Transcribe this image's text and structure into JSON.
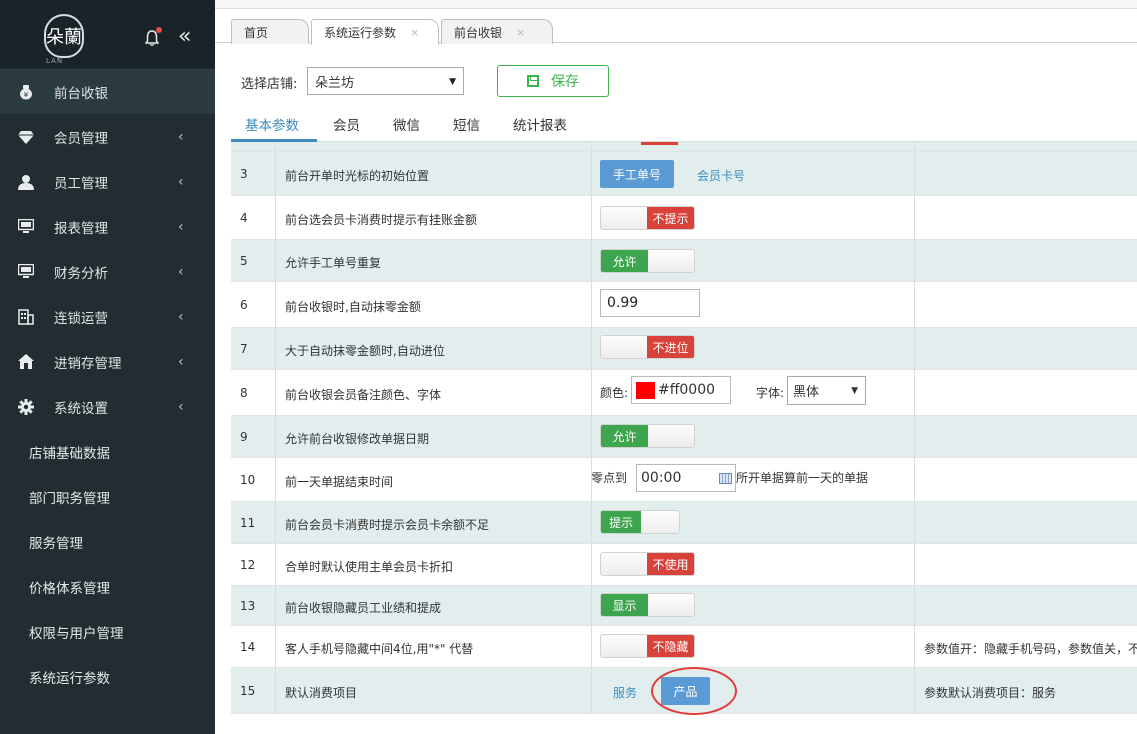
{
  "sidebar": {
    "logo_text": "朵蘭",
    "menu": [
      {
        "label": "前台收银",
        "icon": "money-bag-icon"
      },
      {
        "label": "会员管理",
        "icon": "diamond-icon"
      },
      {
        "label": "员工管理",
        "icon": "user-icon"
      },
      {
        "label": "报表管理",
        "icon": "monitor-icon"
      },
      {
        "label": "财务分析",
        "icon": "monitor-icon"
      },
      {
        "label": "连锁运营",
        "icon": "building-icon"
      },
      {
        "label": "进销存管理",
        "icon": "home-icon"
      },
      {
        "label": "系统设置",
        "icon": "gear-icon"
      }
    ],
    "submenu": [
      "店铺基础数据",
      "部门职务管理",
      "服务管理",
      "价格体系管理",
      "权限与用户管理",
      "系统运行参数"
    ]
  },
  "tabs": [
    {
      "label": "首页"
    },
    {
      "label": "系统运行参数",
      "close": "×"
    },
    {
      "label": "前台收银",
      "close": "×"
    }
  ],
  "toolbar": {
    "store_label": "选择店铺:",
    "store_value": "朵兰坊",
    "save_label": "保存"
  },
  "subtabs": [
    "基本参数",
    "会员",
    "微信",
    "短信",
    "统计报表"
  ],
  "rows": [
    {
      "no": "3",
      "name": "前台开单时光标的初始位置",
      "btn": "手工单号",
      "link": "会员卡号"
    },
    {
      "no": "4",
      "name": "前台选会员卡消费时提示有挂账金额",
      "toggle": "不提示"
    },
    {
      "no": "5",
      "name": "允许手工单号重复",
      "toggle": "允许"
    },
    {
      "no": "6",
      "name": "前台收银时,自动抹零金额",
      "input": "0.99"
    },
    {
      "no": "7",
      "name": "大于自动抹零金额时,自动进位",
      "toggle": "不进位"
    },
    {
      "no": "8",
      "name": "前台收银会员备注颜色、字体",
      "color_label": "颜色:",
      "color_value": "#ff0000",
      "font_label": "字体:",
      "font_value": "黑体"
    },
    {
      "no": "9",
      "name": "允许前台收银修改单据日期",
      "toggle": "允许"
    },
    {
      "no": "10",
      "name": "前一天单据结束时间",
      "pre": "零点到",
      "time": "00:00",
      "post": "所开单据算前一天的单据"
    },
    {
      "no": "11",
      "name": "前台会员卡消费时提示会员卡余额不足",
      "toggle": "提示"
    },
    {
      "no": "12",
      "name": "合单时默认使用主单会员卡折扣",
      "toggle": "不使用"
    },
    {
      "no": "13",
      "name": "前台收银隐藏员工业绩和提成",
      "toggle": "显示"
    },
    {
      "no": "14",
      "name": "客人手机号隐藏中间4位,用\"*\" 代替",
      "toggle": "不隐藏",
      "note": "参数值开：隐藏手机号码，参数值关，不"
    },
    {
      "no": "15",
      "name": "默认消费项目",
      "link": "服务",
      "btn": "产品",
      "note": "参数默认消费项目：服务"
    }
  ],
  "colors": {
    "accent": "#3c8dbc",
    "on": "#3ea54f",
    "off": "#d9423b",
    "row_alt": "#e2eeee",
    "sidebar": "#222d32",
    "swatch": "#ff0000"
  }
}
